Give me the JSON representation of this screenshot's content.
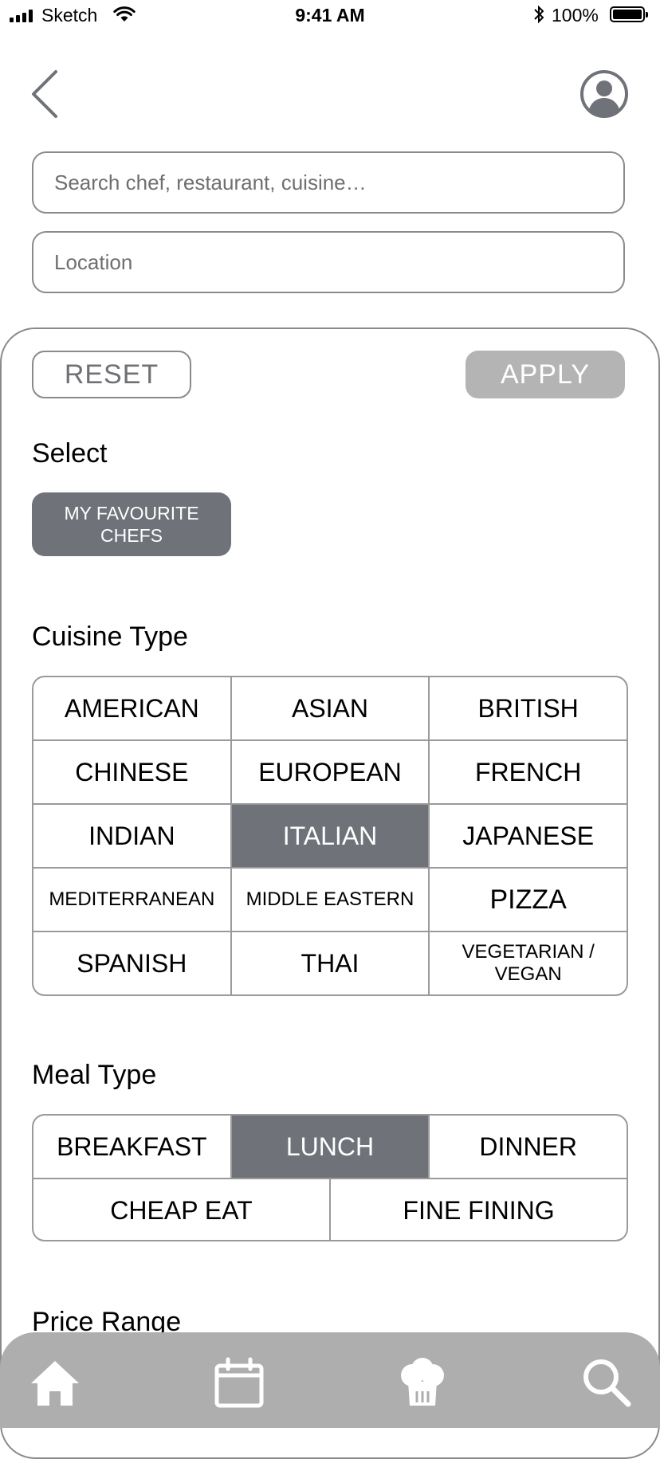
{
  "status_bar": {
    "carrier": "Sketch",
    "time": "9:41 AM",
    "battery": "100%"
  },
  "nav": {
    "back_icon": "chevron-left-icon",
    "profile_icon": "user-circle-icon"
  },
  "search": {
    "placeholder": "Search chef, restaurant, cuisine…",
    "value": ""
  },
  "location": {
    "placeholder": "Location",
    "value": ""
  },
  "filters": {
    "reset_label": "RESET",
    "apply_label": "APPLY",
    "select_title": "Select",
    "favourite_chip": "MY FAVOURITE CHEFS",
    "cuisine_title": "Cuisine Type",
    "cuisines": [
      "AMERICAN",
      "ASIAN",
      "BRITISH",
      "CHINESE",
      "EUROPEAN",
      "FRENCH",
      "INDIAN",
      "ITALIAN",
      "JAPANESE",
      "MEDITERRANEAN",
      "MIDDLE EASTERN",
      "PIZZA",
      "SPANISH",
      "THAI",
      "VEGETARIAN / VEGAN"
    ],
    "cuisine_selected": "ITALIAN",
    "meal_title": "Meal Type",
    "meals": [
      "BREAKFAST",
      "LUNCH",
      "DINNER",
      "CHEAP EAT",
      "FINE FINING"
    ],
    "meal_selected": "LUNCH",
    "price_title": "Price Range"
  },
  "tab_bar": {
    "items": [
      "home-icon",
      "calendar-icon",
      "chef-hat-icon",
      "search-icon"
    ]
  },
  "colors": {
    "selected": "#6f7278",
    "apply_bg": "#b4b4b4",
    "tab_bar_bg": "#aeaeae",
    "border": "#9a9a9a"
  }
}
